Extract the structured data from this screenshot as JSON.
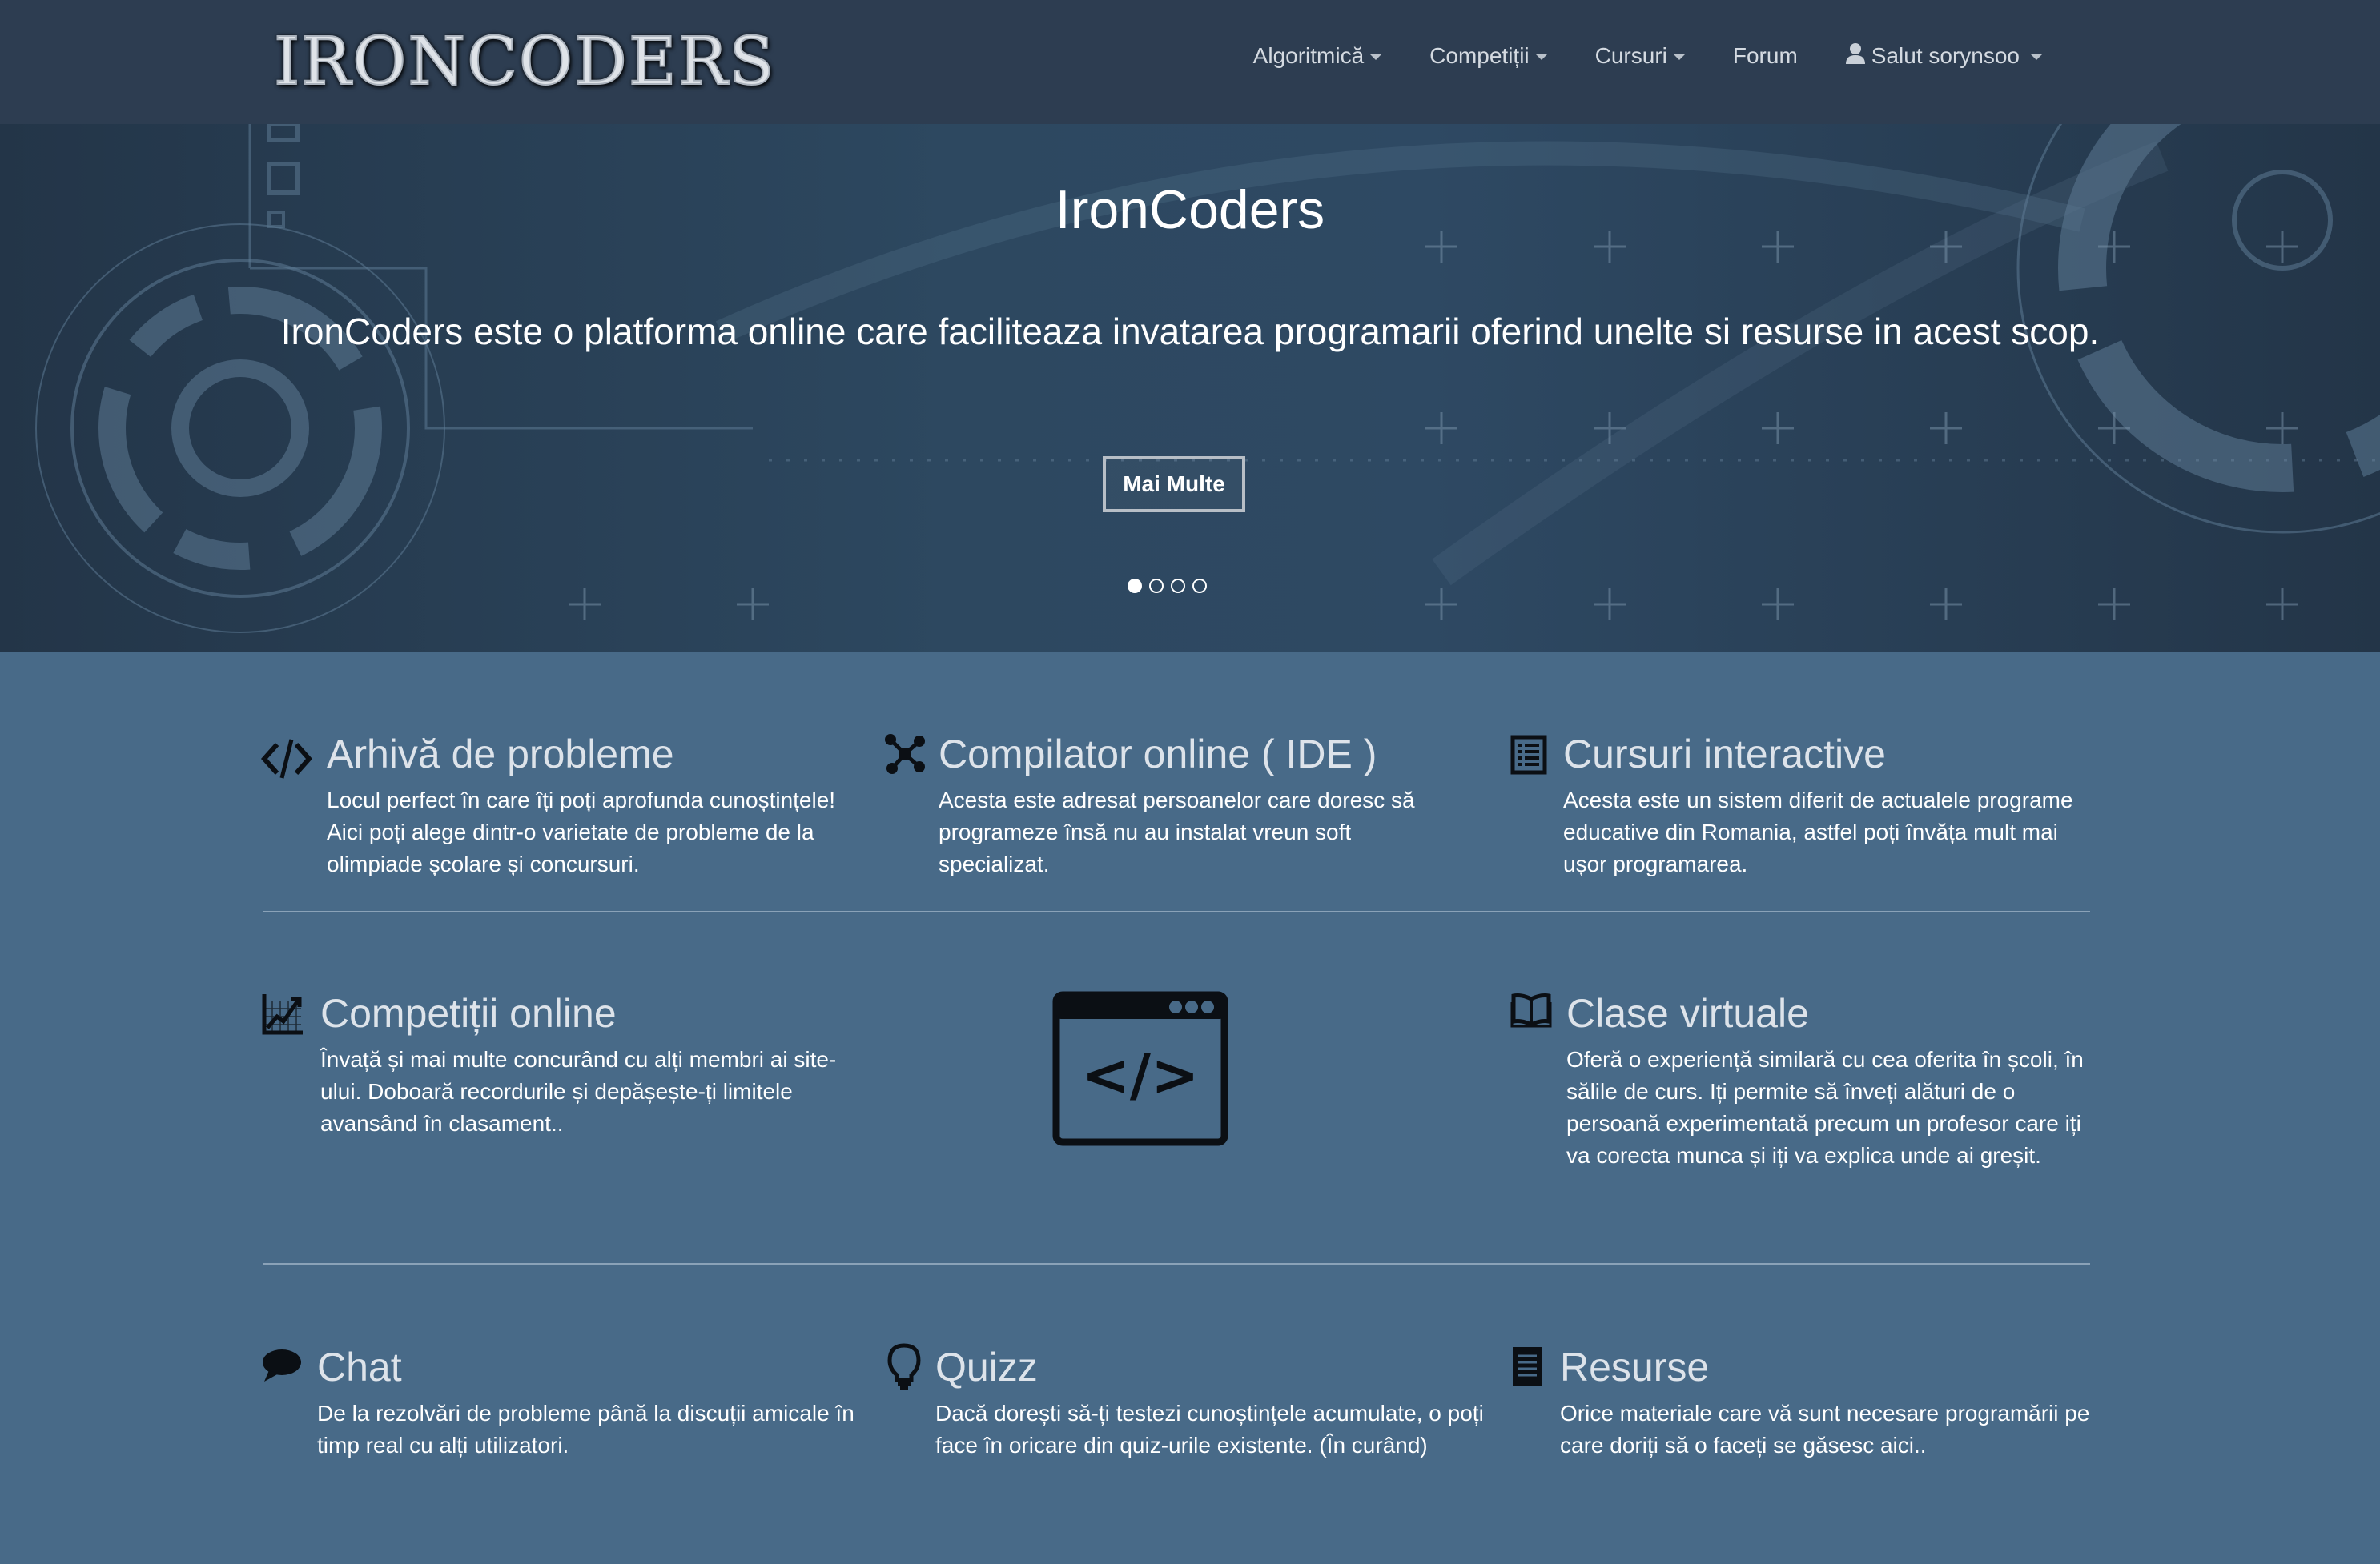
{
  "brand": {
    "logo_text": "IRONCODERS"
  },
  "nav": {
    "items": [
      {
        "label": "Algoritmică",
        "dropdown": true
      },
      {
        "label": "Competiții",
        "dropdown": true
      },
      {
        "label": "Cursuri",
        "dropdown": true
      },
      {
        "label": "Forum",
        "dropdown": false
      },
      {
        "label": "Salut sorynsoo",
        "dropdown": true,
        "icon": "user-icon"
      }
    ]
  },
  "hero": {
    "title": "IronCoders",
    "text": "IronCoders este o platforma online care faciliteaza invatarea programarii oferind unelte si resurse in acest scop.",
    "button_label": "Mai Multe",
    "slides": 4,
    "active_slide": 1
  },
  "features": [
    {
      "icon": "code-icon",
      "title": "Arhivă de probleme",
      "desc": "Locul perfect în care îți poți aprofunda cunoștințele! Aici poți alege dintr-o varietate de probleme de la olimpiade școlare și concursuri."
    },
    {
      "icon": "network-icon",
      "title": "Compilator online ( IDE )",
      "desc": "Acesta este adresat persoanelor care doresc să programeze însă nu au instalat vreun soft specializat."
    },
    {
      "icon": "list-icon",
      "title": "Cursuri interactive",
      "desc": "Acesta este un sistem diferit de actualele programe educative din Romania, astfel poți învăța mult mai ușor programarea."
    },
    {
      "icon": "chart-icon",
      "title": "Competiții online",
      "desc": "Învață și mai multe concurând cu alți membri ai site-ului. Doboară recordurile și depășește-ți limitele avansând în clasament.."
    },
    {
      "icon": "book-icon",
      "title": "Clase virtuale",
      "desc": "Oferă o experiență similară cu cea oferita în școli, în sălile de curs. Iți permite să înveți alături de o persoană experimentată precum un profesor care iți va corecta munca și iți va explica unde ai greșit."
    },
    {
      "icon": "chat-bubble-icon",
      "title": "Chat",
      "desc": "De la rezolvări de probleme până la discuții amicale în timp real cu alți utilizatori."
    },
    {
      "icon": "lightbulb-icon",
      "title": "Quizz",
      "desc": "Dacă dorești să-ți testezi cunoștințele acumulate, o poți face în oricare din quiz-urile existente. (În curând)"
    },
    {
      "icon": "document-icon",
      "title": "Resurse",
      "desc": "Orice materiale care vă sunt necesare programării pe care doriți să o faceți se găsesc aici.."
    }
  ],
  "center_graphic": {
    "icon": "code-window-icon",
    "text": "</>"
  },
  "colors": {
    "navbar_bg": "#2d3d51",
    "hero_bg": "#2d4860",
    "page_bg": "#486a88",
    "feature_title": "#dde3ea"
  }
}
